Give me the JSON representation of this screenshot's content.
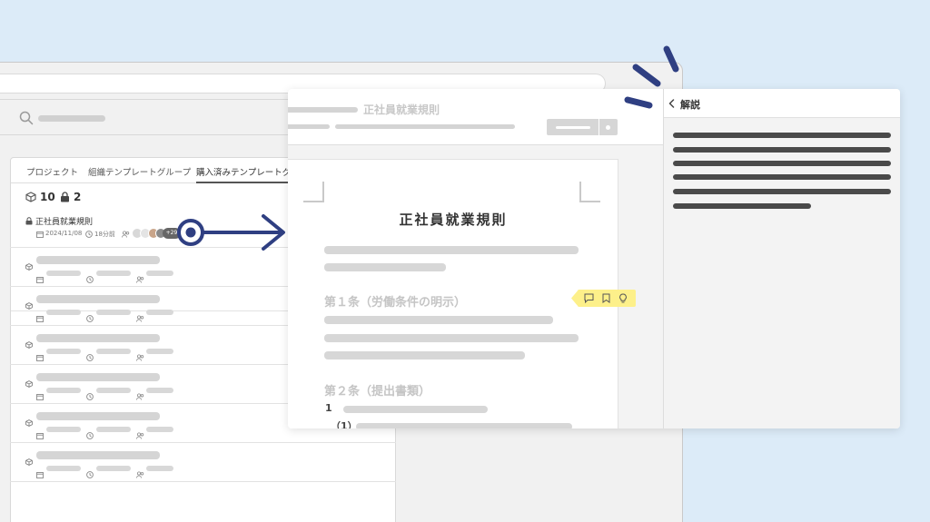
{
  "back_window": {
    "tabs": [
      "プロジェクト",
      "組織テンプレートグループ",
      "購入済みテンプレートグル"
    ],
    "active_tab_index": 2,
    "stats": {
      "template_count": "10",
      "locked_count": "2"
    },
    "first_item": {
      "title": "正社員就業規則",
      "date": "2024/11/08",
      "time_ago": "18分前",
      "member_overflow": "+29"
    },
    "placeholder_row_count": 6
  },
  "front_window": {
    "header_title": "正社員就業規則",
    "document": {
      "title": "正社員就業規則",
      "article1_heading": "第１条（労働条件の明示）",
      "article2_heading": "第２条（提出書類）",
      "item_number": "1",
      "sub_item_number": "（1）"
    },
    "comment_toolbar_icons": [
      "comment-icon",
      "bookmark-icon",
      "lightbulb-icon"
    ],
    "side_panel": {
      "title": "解説"
    }
  },
  "colors": {
    "background": "#dcebf8",
    "accent": "#2f3f82",
    "highlight": "#fdf08a"
  }
}
